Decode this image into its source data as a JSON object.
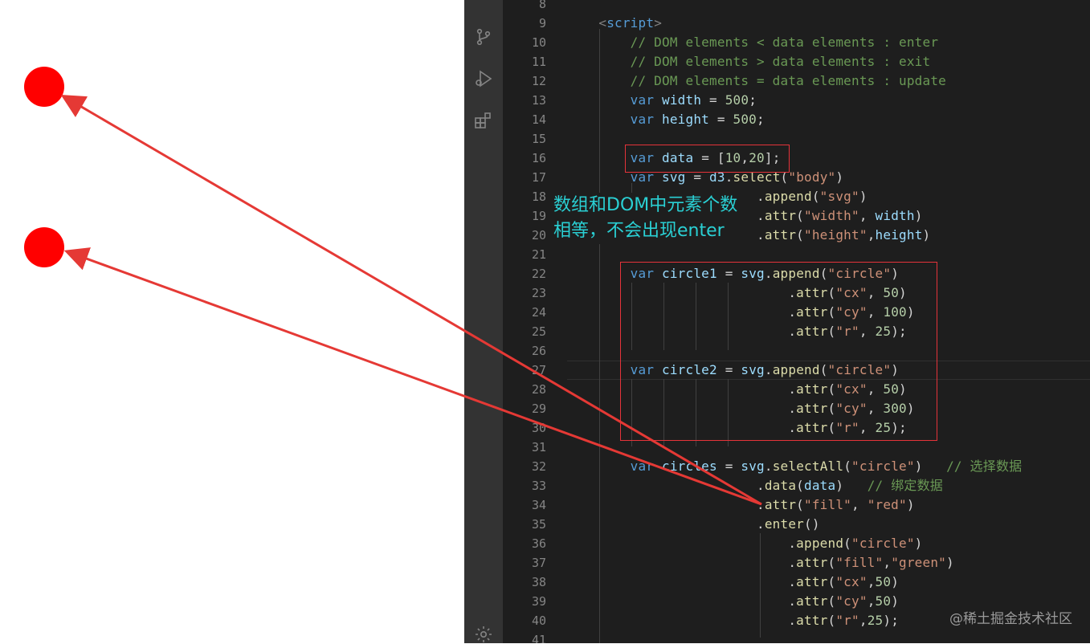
{
  "preview": {
    "circles": [
      "red-circle",
      "red-circle"
    ],
    "circle_color": "#ff0000"
  },
  "activity_bar": {
    "icons": [
      "source-control-icon",
      "run-debug-icon",
      "extensions-icon",
      "settings-gear-icon"
    ]
  },
  "editor": {
    "lines": [
      {
        "n": "8",
        "code": ""
      },
      {
        "n": "9",
        "code": "    <script>"
      },
      {
        "n": "10",
        "code": "        // DOM elements < data elements : enter"
      },
      {
        "n": "11",
        "code": "        // DOM elements > data elements : exit"
      },
      {
        "n": "12",
        "code": "        // DOM elements = data elements : update"
      },
      {
        "n": "13",
        "code": "        var width = 500;"
      },
      {
        "n": "14",
        "code": "        var height = 500;"
      },
      {
        "n": "15",
        "code": ""
      },
      {
        "n": "16",
        "code": "        var data = [10,20];"
      },
      {
        "n": "17",
        "code": "        var svg = d3.select(\"body\")"
      },
      {
        "n": "18",
        "code": "                        .append(\"svg\")"
      },
      {
        "n": "19",
        "code": "                        .attr(\"width\", width)"
      },
      {
        "n": "20",
        "code": "                        .attr(\"height\",height)"
      },
      {
        "n": "21",
        "code": ""
      },
      {
        "n": "22",
        "code": "        var circle1 = svg.append(\"circle\")"
      },
      {
        "n": "23",
        "code": "                            .attr(\"cx\", 50)"
      },
      {
        "n": "24",
        "code": "                            .attr(\"cy\", 100)"
      },
      {
        "n": "25",
        "code": "                            .attr(\"r\", 25);"
      },
      {
        "n": "26",
        "code": ""
      },
      {
        "n": "27",
        "code": "        var circle2 = svg.append(\"circle\")"
      },
      {
        "n": "28",
        "code": "                            .attr(\"cx\", 50)"
      },
      {
        "n": "29",
        "code": "                            .attr(\"cy\", 300)"
      },
      {
        "n": "30",
        "code": "                            .attr(\"r\", 25);"
      },
      {
        "n": "31",
        "code": ""
      },
      {
        "n": "32",
        "code": "        var circles = svg.selectAll(\"circle\")   // 选择数据"
      },
      {
        "n": "33",
        "code": "                        .data(data)   // 绑定数据"
      },
      {
        "n": "34",
        "code": "                        .attr(\"fill\", \"red\")"
      },
      {
        "n": "35",
        "code": "                        .enter()"
      },
      {
        "n": "36",
        "code": "                            .append(\"circle\")"
      },
      {
        "n": "37",
        "code": "                            .attr(\"fill\",\"green\")"
      },
      {
        "n": "38",
        "code": "                            .attr(\"cx\",50)"
      },
      {
        "n": "39",
        "code": "                            .attr(\"cy\",50)"
      },
      {
        "n": "40",
        "code": "                            .attr(\"r\",25);"
      },
      {
        "n": "41",
        "code": ""
      }
    ]
  },
  "annotation": {
    "line1": "数组和DOM中元素个数",
    "line2": "相等，不会出现enter"
  },
  "colors": {
    "highlight_box": "#e5333a",
    "arrow": "#e53935",
    "annotation_text": "#2ad0d4"
  },
  "watermark": "@稀土掘金技术社区"
}
